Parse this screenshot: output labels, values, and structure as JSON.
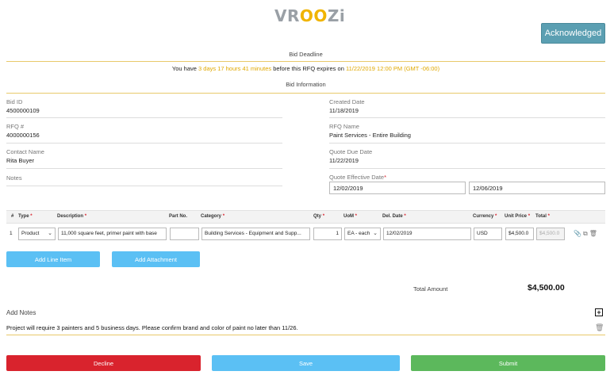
{
  "logo": {
    "text_main": "VR",
    "text_accent": "OO",
    "text_end": "Zi"
  },
  "header": {
    "acknowledged_label": "Acknowledged"
  },
  "deadline": {
    "section_label": "Bid Deadline",
    "prefix": "You have ",
    "remaining": "3 days 17 hours 41 minutes",
    "middle": " before this RFQ expires on ",
    "expires": "11/22/2019 12:00 PM (GMT -06:00)"
  },
  "bid_info": {
    "section_label": "Bid Information",
    "bid_id_label": "Bid ID",
    "bid_id": "4500000109",
    "rfq_label": "RFQ #",
    "rfq": "4000000156",
    "contact_label": "Contact Name",
    "contact": "Rita Buyer",
    "notes_label": "Notes",
    "created_label": "Created Date",
    "created": "11/18/2019",
    "rfq_name_label": "RFQ Name",
    "rfq_name": "Paint Services - Entire Building",
    "quote_due_label": "Quote Due Date",
    "quote_due": "11/22/2019",
    "effective_label": "Quote Effective Date",
    "effective_from": "12/02/2019",
    "effective_to": "12/06/2019"
  },
  "table": {
    "headers": {
      "num": "#",
      "type": "Type",
      "description": "Description",
      "part_no": "Part No.",
      "category": "Category",
      "qty": "Qty",
      "uom": "UoM",
      "del_date": "Del. Date",
      "currency": "Currency",
      "unit_price": "Unit Price",
      "total": "Total"
    },
    "rows": [
      {
        "num": "1",
        "type": "Product",
        "description": "11,000 square feet, primer paint with base",
        "part_no": "",
        "category": "Building Services - Equipment and Supp...",
        "qty": "1",
        "uom": "EA - each",
        "del_date": "12/02/2019",
        "currency": "USD",
        "unit_price": "$4,500.0",
        "total": "$4,500.0"
      }
    ]
  },
  "buttons": {
    "add_line_item": "Add Line Item",
    "add_attachment": "Add Attachment",
    "decline": "Decline",
    "save": "Save",
    "submit": "Submit"
  },
  "totals": {
    "label": "Total Amount",
    "value": "$4,500.00"
  },
  "notes": {
    "label": "Add Notes",
    "text": "Project will require 3 painters and 5 business days. Please confirm brand and color of paint no later than 11/26."
  },
  "colors": {
    "accent_gold": "#e0a800",
    "acknowledged": "#5b9fb2",
    "button_blue": "#5bc0f4",
    "decline_red": "#d9232d",
    "submit_green": "#5cb85c"
  },
  "icons": [
    "paperclip-icon",
    "copy-icon",
    "trash-icon",
    "plus-box-icon",
    "chevron-down-icon"
  ]
}
